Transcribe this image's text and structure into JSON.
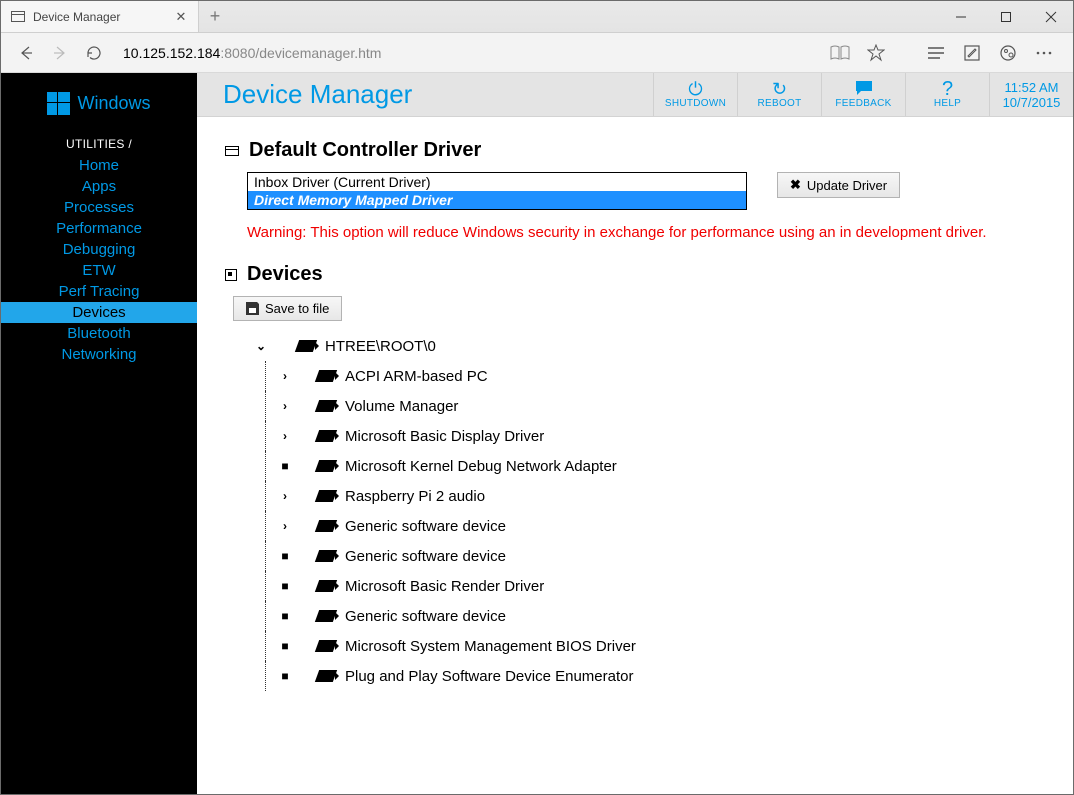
{
  "browser": {
    "tab_title": "Device Manager",
    "url_host": "10.125.152.184",
    "url_rest": ":8080/devicemanager.htm"
  },
  "brand": "Windows",
  "sidebar": {
    "label": "UTILITIES /",
    "items": [
      {
        "label": "Home"
      },
      {
        "label": "Apps"
      },
      {
        "label": "Processes"
      },
      {
        "label": "Performance"
      },
      {
        "label": "Debugging"
      },
      {
        "label": "ETW"
      },
      {
        "label": "Perf Tracing"
      },
      {
        "label": "Devices",
        "active": true
      },
      {
        "label": "Bluetooth"
      },
      {
        "label": "Networking"
      }
    ]
  },
  "page_title": "Device Manager",
  "toolbar": {
    "shutdown": "SHUTDOWN",
    "reboot": "REBOOT",
    "feedback": "FEEDBACK",
    "help": "HELP",
    "time": "11:52 AM",
    "date": "10/7/2015"
  },
  "driver": {
    "section_title": "Default Controller Driver",
    "options": [
      {
        "label": "Inbox Driver (Current Driver)"
      },
      {
        "label": "Direct Memory Mapped Driver",
        "selected": true
      }
    ],
    "update_button": "Update Driver",
    "warning": "Warning: This option will reduce Windows security in exchange for performance using an in development driver."
  },
  "devices": {
    "section_title": "Devices",
    "save_button": "Save to file",
    "root": "HTREE\\ROOT\\0",
    "children": [
      {
        "label": "ACPI ARM-based PC",
        "exp": ">"
      },
      {
        "label": "Volume Manager",
        "exp": ">"
      },
      {
        "label": "Microsoft Basic Display Driver",
        "exp": ">"
      },
      {
        "label": "Microsoft Kernel Debug Network Adapter",
        "exp": "■"
      },
      {
        "label": "Raspberry Pi 2 audio",
        "exp": ">"
      },
      {
        "label": "Generic software device",
        "exp": ">"
      },
      {
        "label": "Generic software device",
        "exp": "■"
      },
      {
        "label": "Microsoft Basic Render Driver",
        "exp": "■"
      },
      {
        "label": "Generic software device",
        "exp": "■"
      },
      {
        "label": "Microsoft System Management BIOS Driver",
        "exp": "■"
      },
      {
        "label": "Plug and Play Software Device Enumerator",
        "exp": "■"
      }
    ]
  }
}
